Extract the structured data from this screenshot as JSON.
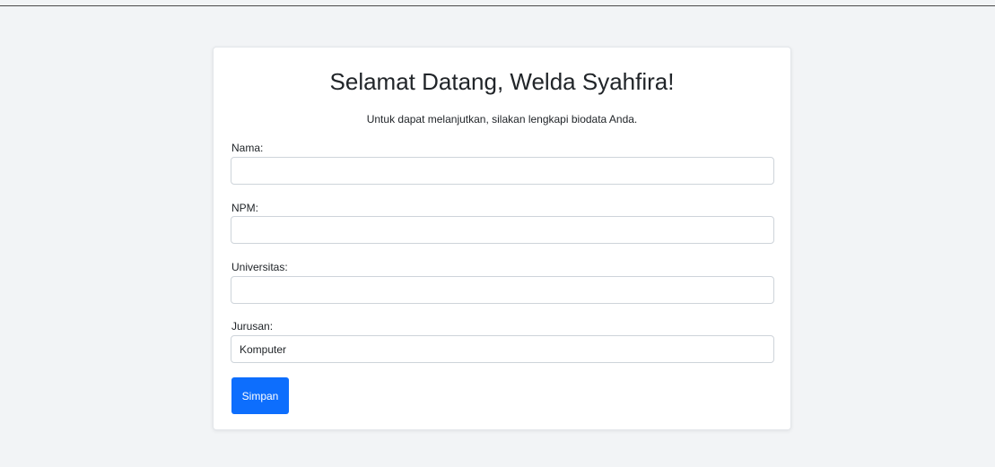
{
  "welcome": {
    "title": "Selamat Datang, Welda Syahfira!",
    "subtitle": "Untuk dapat melanjutkan, silakan lengkapi biodata Anda."
  },
  "form": {
    "fields": [
      {
        "label": "Nama:",
        "value": "",
        "placeholder": ""
      },
      {
        "label": "NPM:",
        "value": "",
        "placeholder": ""
      },
      {
        "label": "Universitas:",
        "value": "",
        "placeholder": ""
      },
      {
        "label": "Jurusan:",
        "value": "Komputer",
        "placeholder": ""
      }
    ],
    "submit_label": "Simpan"
  },
  "colors": {
    "page_background": "#f2f4f6",
    "card_background": "#ffffff",
    "primary_button": "#0d6efd",
    "input_border": "#ced4da",
    "text": "#212529"
  }
}
